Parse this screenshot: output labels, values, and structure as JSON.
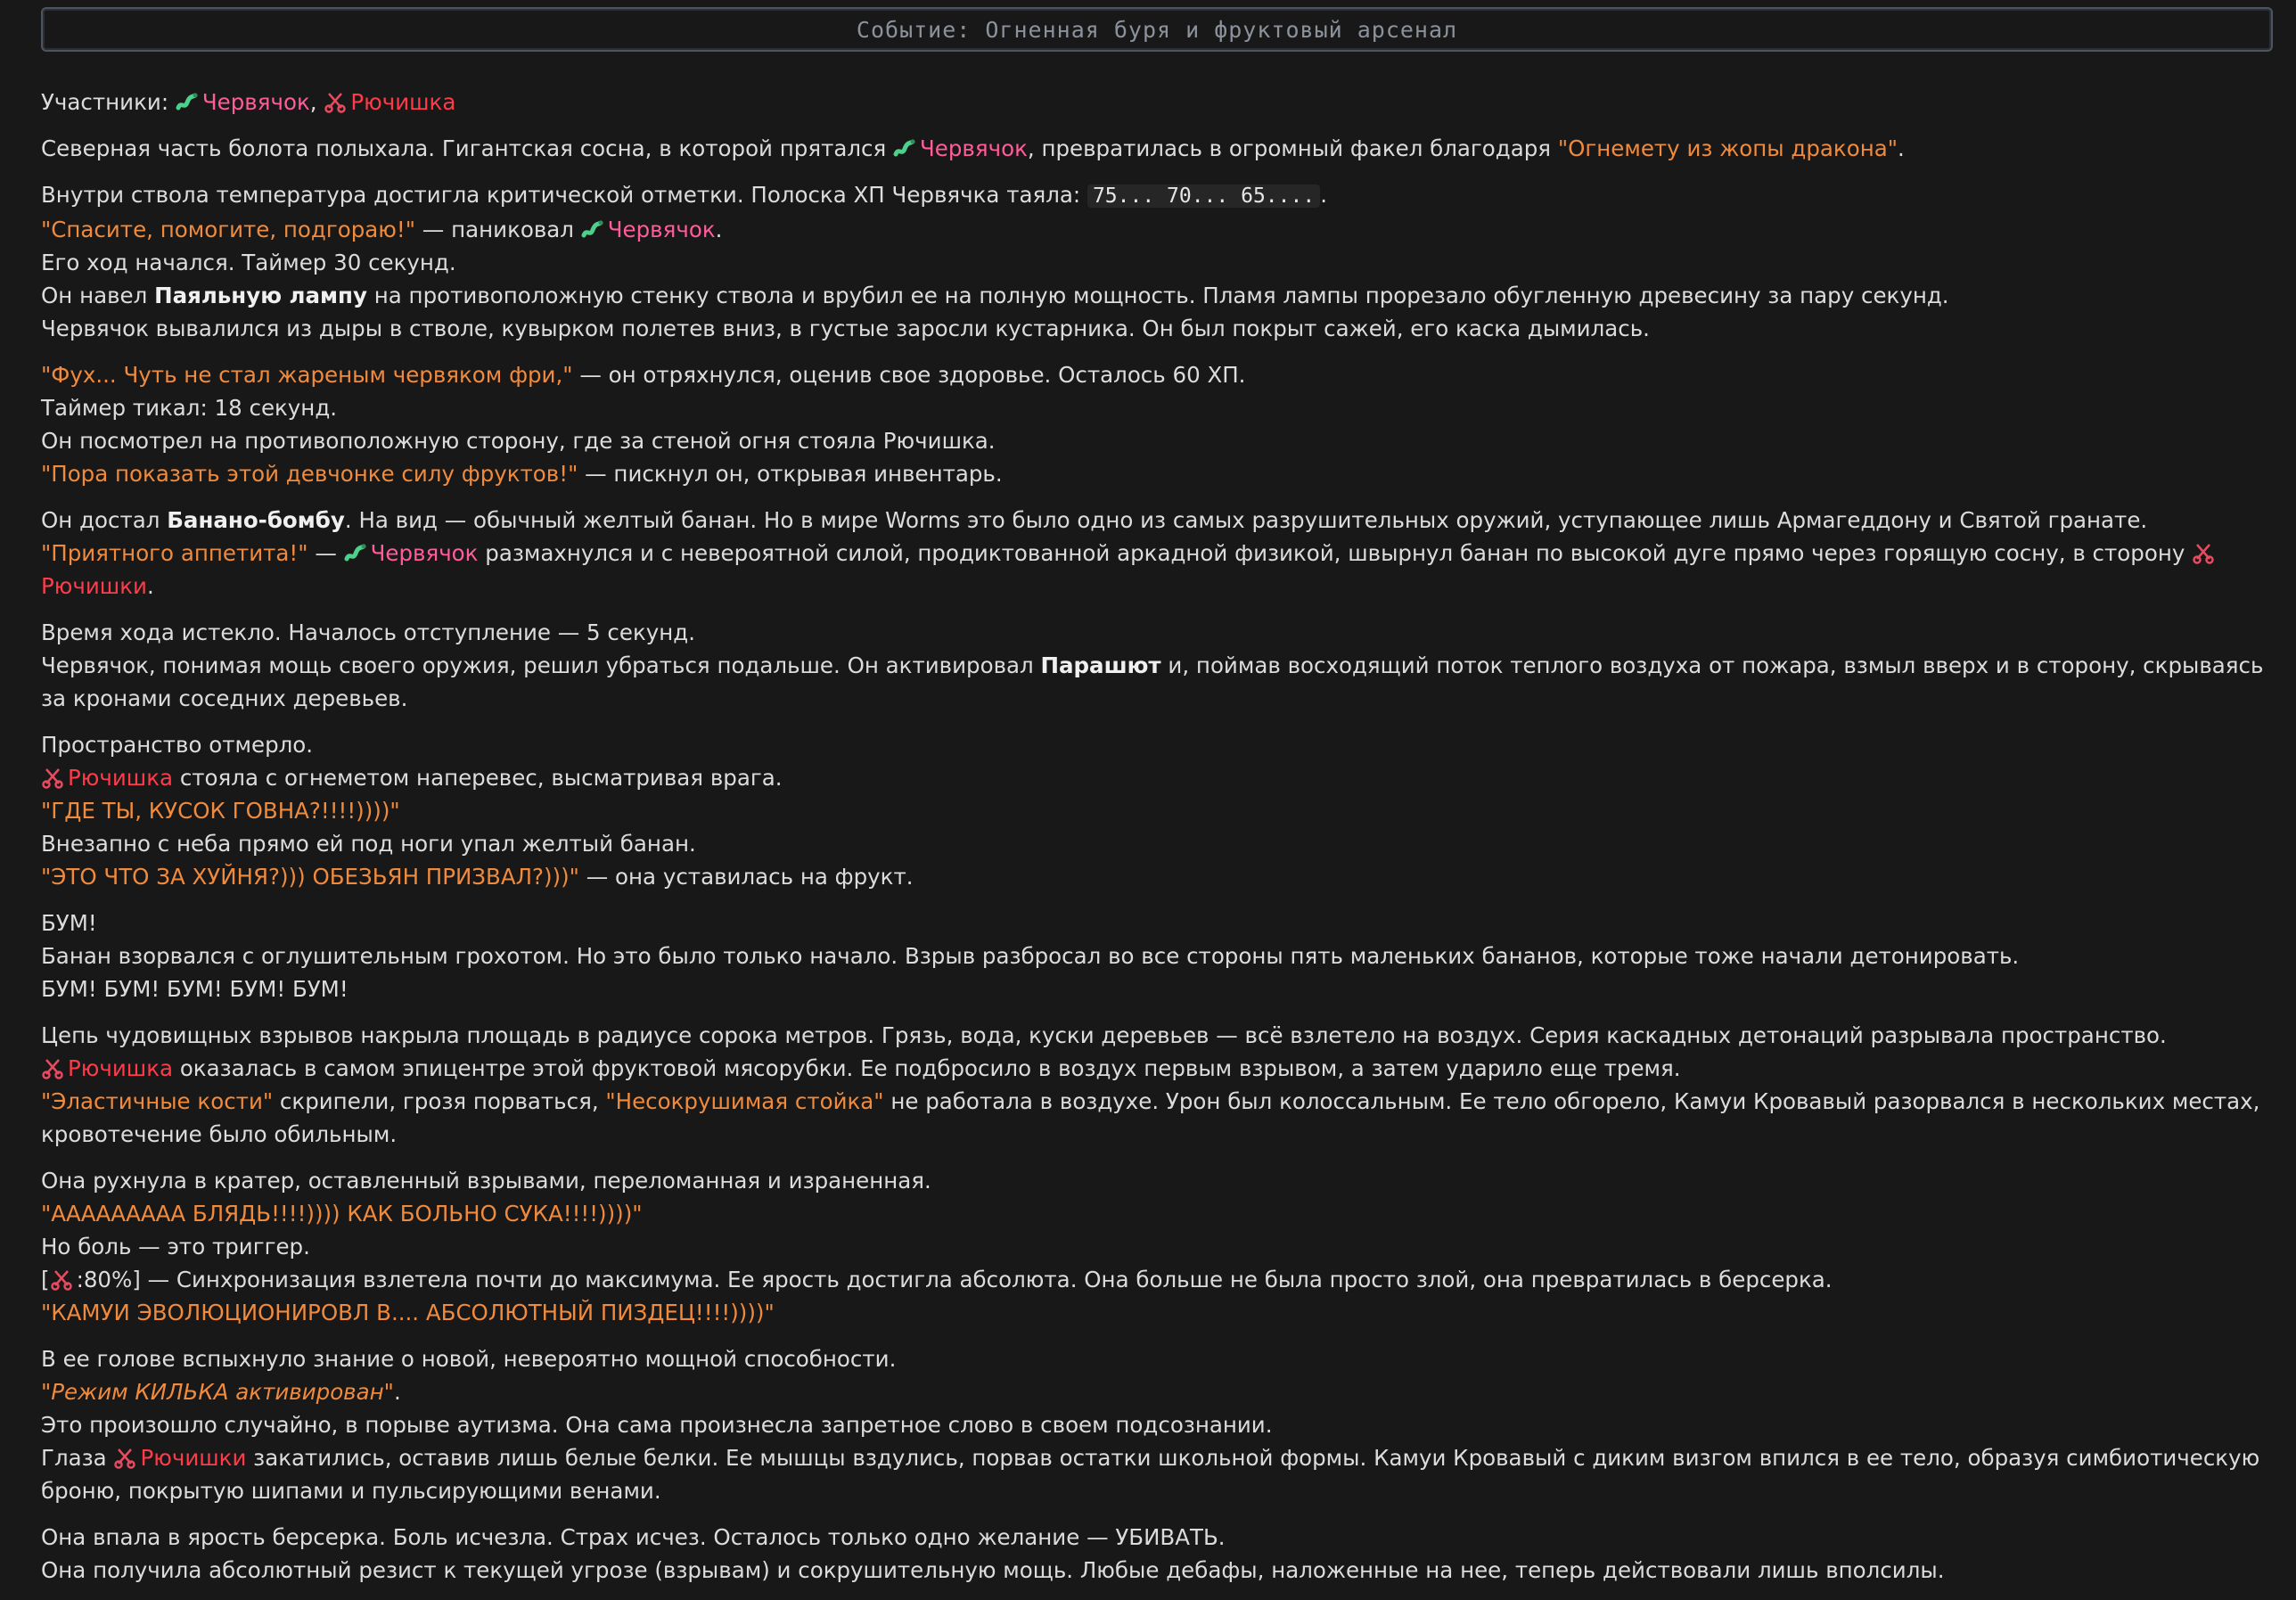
{
  "header": {
    "title": "Событие: Огненная буря и фруктовый арсенал"
  },
  "characters": {
    "worm": "Червячок",
    "ryu": "Рючишка",
    "ryu_gen": "Рючишки"
  },
  "icons": {
    "worm": "worm-icon",
    "ryu": "scissors-icon"
  },
  "colors": {
    "quote": "#f08a3c",
    "worm": "#ff5c99",
    "ryu": "#ff3b4a",
    "header_border": "#4d5560"
  },
  "paragraphs": {
    "participants": {
      "label": "Участники: ",
      "sep": ", "
    },
    "p1": {
      "a": "Северная часть болота полыхала. Гигантская сосна, в которой прятался ",
      "b": ", превратилась в огромный факел благодаря ",
      "q": "\"Огнемету из жопы дракона\"",
      "c": "."
    },
    "p2": {
      "l1a": "Внутри ствола температура достигла критической отметки. Полоска ХП Червячка таяла: ",
      "l1code": "75... 70... 65....",
      "l1b": ".",
      "l2q": "\"Спасите, помогите, подгораю!\"",
      "l2a": " — паниковал ",
      "l2b": ".",
      "l3": "Его ход начался. Таймер 30 секунд.",
      "l4a": "Он навел ",
      "l4b": "Паяльную лампу",
      "l4c": " на противоположную стенку ствола и врубил ее на полную мощность. Пламя лампы прорезало обугленную древесину за пару секунд.",
      "l5": "Червячок вывалился из дыры в стволе, кувырком полетев вниз, в густые заросли кустарника. Он был покрыт сажей, его каска дымилась."
    },
    "p3": {
      "l1q": "\"Фух... Чуть не стал жареным червяком фри,\"",
      "l1a": " — он отряхнулся, оценив свое здоровье. Осталось 60 ХП.",
      "l2": "Таймер тикал: 18 секунд.",
      "l3": "Он посмотрел на противоположную сторону, где за стеной огня стояла Рючишка.",
      "l4q": "\"Пора показать этой девчонке силу фруктов!\"",
      "l4a": " — пискнул он, открывая инвентарь."
    },
    "p4": {
      "l1a": "Он достал ",
      "l1b": "Банано-бомбу",
      "l1c": ". На вид — обычный желтый банан. Но в мире Worms это было одно из самых разрушительных оружий, уступающее лишь Армагеддону и Святой гранате.",
      "l2q": "\"Приятного аппетита!\"",
      "l2a": " — ",
      "l2b": " размахнулся и с невероятной силой, продиктованной аркадной физикой, швырнул банан по высокой дуге прямо через горящую сосну, в сторону ",
      "l2c": "."
    },
    "p5": {
      "l1": "Время хода истекло. Началось отступление — 5 секунд.",
      "l2a": "Червячок, понимая мощь своего оружия, решил убраться подальше. Он активировал ",
      "l2b": "Парашют",
      "l2c": " и, поймав восходящий поток теплого воздуха от пожара, взмыл вверх и в сторону, скрываясь за кронами соседних деревьев."
    },
    "p6": {
      "l1": "Пространство отмерло.",
      "l2a": " стояла с огнеметом наперевес, высматривая врага.",
      "l3q": "\"ГДЕ ТЫ, КУСОК ГОВНА?!!!!))))\"",
      "l4": "Внезапно с неба прямо ей под ноги упал желтый банан.",
      "l5q": "\"ЭТО ЧТО ЗА ХУЙНЯ?))) ОБЕЗЬЯН ПРИЗВАЛ?)))\"",
      "l5a": " — она уставилась на фрукт."
    },
    "p7": {
      "l1": "БУМ!",
      "l2": "Банан взорвался с оглушительным грохотом. Но это было только начало. Взрыв разбросал во все стороны пять маленьких бананов, которые тоже начали детонировать.",
      "l3": "БУМ! БУМ! БУМ! БУМ! БУМ!"
    },
    "p8": {
      "l1": "Цепь чудовищных взрывов накрыла площадь в радиусе сорока метров. Грязь, вода, куски деревьев — всё взлетело на воздух. Серия каскадных детонаций разрывала пространство.",
      "l2a": " оказалась в самом эпицентре этой фруктовой мясорубки. Ее подбросило в воздух первым взрывом, а затем ударило еще тремя.",
      "l3q1": "\"Эластичные кости\"",
      "l3a": " скрипели, грозя порваться, ",
      "l3q2": "\"Несокрушимая стойка\"",
      "l3b": " не работала в воздухе. Урон был колоссальным. Ее тело обгорело, Камуи Кровавый разорвался в нескольких местах, кровотечение было обильным."
    },
    "p9": {
      "l1": "Она рухнула в кратер, оставленный взрывами, переломанная и израненная.",
      "l2q": "\"ААААААААА БЛЯДЬ!!!!)))) КАК БОЛЬНО СУКА!!!!))))\"",
      "l3": "Но боль — это триггер.",
      "l4a": "[",
      "l4b": ":80%] — Синхронизация взлетела почти до максимума. Ее ярость достигла абсолюта. Она больше не была просто злой, она превратилась в берсерка.",
      "l5q": "\"КАМУИ ЭВОЛЮЦИОНИРОВЛ В.... АБСОЛЮТНЫЙ ПИЗДЕЦ!!!!))))\""
    },
    "p10": {
      "l1": "В ее голове вспыхнуло знание о новой, невероятно мощной способности.",
      "l2q": "\"Режим КИЛЬКА активирован\"",
      "l2a": ".",
      "l3": "Это произошло случайно, в порыве аутизма. Она сама произнесла запретное слово в своем подсознании.",
      "l4a": "Глаза ",
      "l4b": " закатились, оставив лишь белые белки. Ее мышцы вздулись, порвав остатки школьной формы. Камуи Кровавый с диким визгом впился в ее тело, образуя симбиотическую броню, покрытую шипами и пульсирующими венами."
    },
    "p11": {
      "l1": "Она впала в ярость берсерка. Боль исчезла. Страх исчез. Осталось только одно желание — УБИВАТЬ.",
      "l2": "Она получила абсолютный резист к текущей угрозе (взрывам) и сокрушительную мощь. Любые дебафы, наложенные на нее, теперь действовали лишь вполсилы."
    }
  }
}
